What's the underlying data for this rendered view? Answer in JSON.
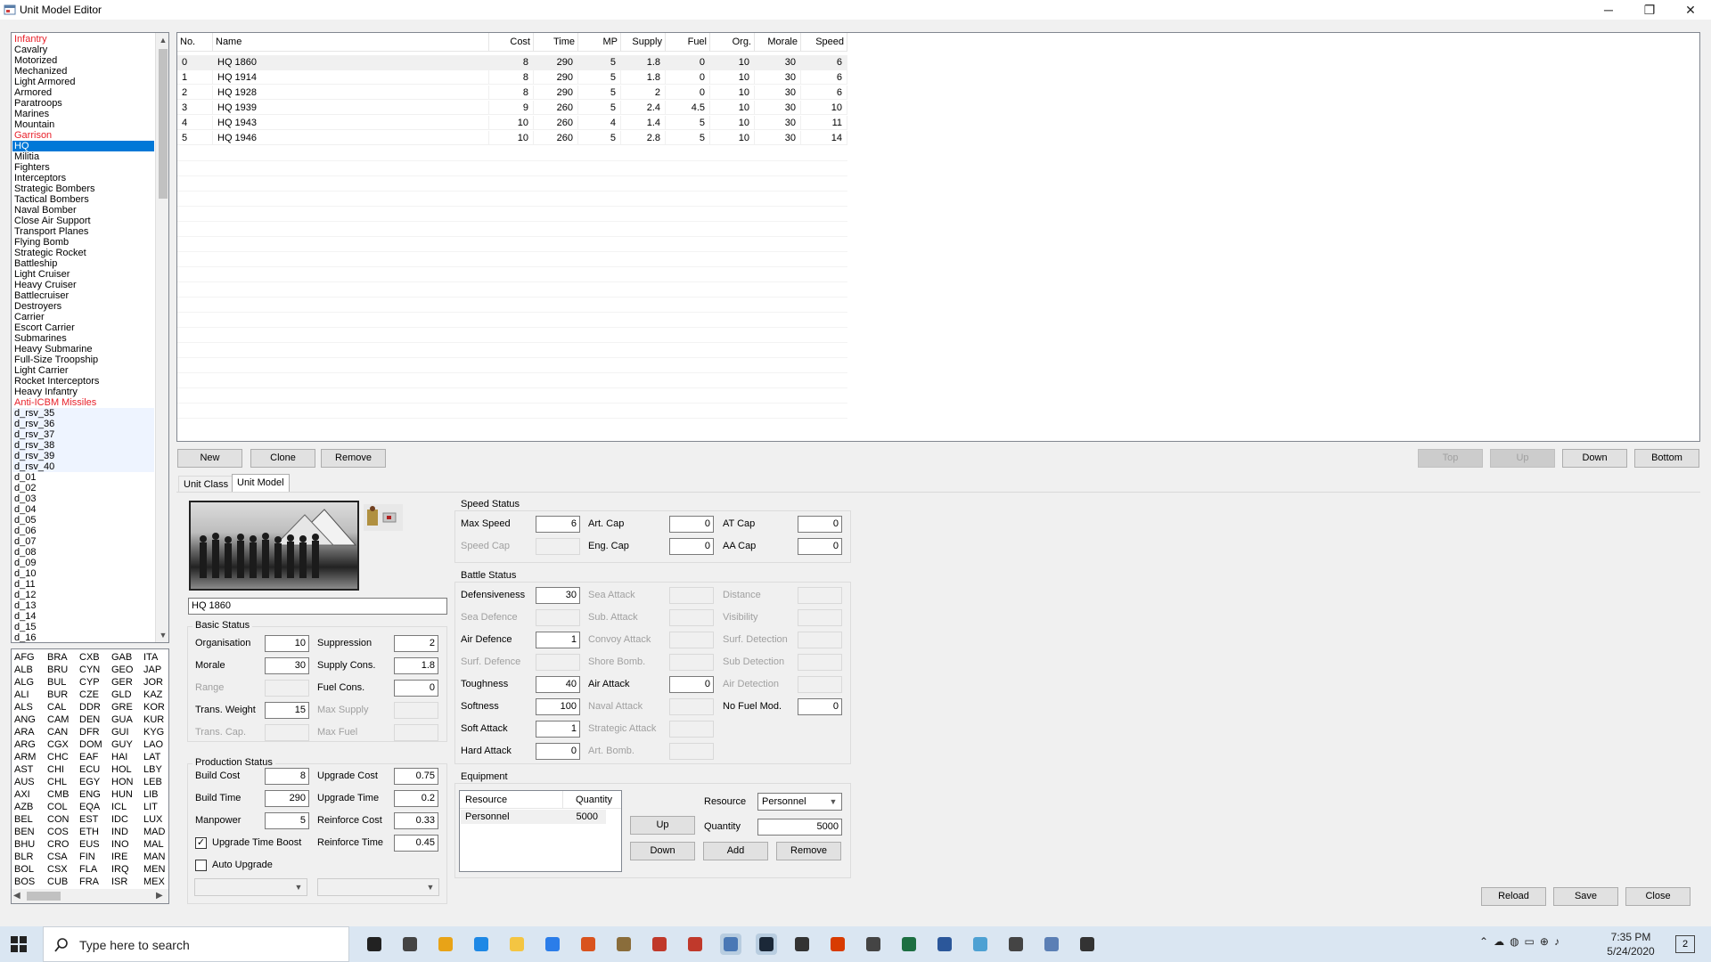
{
  "window": {
    "title": "Unit Model Editor",
    "minimize": "─",
    "restore": "❐",
    "close": "✕"
  },
  "unit_classes": [
    "Infantry",
    "Cavalry",
    "Motorized",
    "Mechanized",
    "Light Armored",
    "Armored",
    "Paratroops",
    "Marines",
    "Mountain",
    "Garrison",
    "HQ",
    "Militia",
    "Fighters",
    "Interceptors",
    "Strategic Bombers",
    "Tactical Bombers",
    "Naval Bomber",
    "Close Air Support",
    "Transport Planes",
    "Flying Bomb",
    "Strategic Rocket",
    "Battleship",
    "Light Cruiser",
    "Heavy Cruiser",
    "Battlecruiser",
    "Destroyers",
    "Carrier",
    "Escort Carrier",
    "Submarines",
    "Heavy Submarine",
    "Full-Size Troopship",
    "Light Carrier",
    "Rocket Interceptors",
    "Heavy Infantry",
    "Anti-ICBM Missiles",
    "d_rsv_35",
    "d_rsv_36",
    "d_rsv_37",
    "d_rsv_38",
    "d_rsv_39",
    "d_rsv_40",
    "d_01",
    "d_02",
    "d_03",
    "d_04",
    "d_05",
    "d_06",
    "d_07",
    "d_08",
    "d_09",
    "d_10",
    "d_11",
    "d_12",
    "d_13",
    "d_14",
    "d_15",
    "d_16"
  ],
  "unit_class_colors": {
    "red": "#e8202a",
    "selected_bg": "#0078d7"
  },
  "countries": [
    [
      "AFG",
      "BRA",
      "CXB",
      "GAB",
      "ITA"
    ],
    [
      "ALB",
      "BRU",
      "CYN",
      "GEO",
      "JAP"
    ],
    [
      "ALG",
      "BUL",
      "CYP",
      "GER",
      "JOR"
    ],
    [
      "ALI",
      "BUR",
      "CZE",
      "GLD",
      "KAZ"
    ],
    [
      "ALS",
      "CAL",
      "DDR",
      "GRE",
      "KOR"
    ],
    [
      "ANG",
      "CAM",
      "DEN",
      "GUA",
      "KUR"
    ],
    [
      "ARA",
      "CAN",
      "DFR",
      "GUI",
      "KYG"
    ],
    [
      "ARG",
      "CGX",
      "DOM",
      "GUY",
      "LAO"
    ],
    [
      "ARM",
      "CHC",
      "EAF",
      "HAI",
      "LAT"
    ],
    [
      "AST",
      "CHI",
      "ECU",
      "HOL",
      "LBY"
    ],
    [
      "AUS",
      "CHL",
      "EGY",
      "HON",
      "LEB"
    ],
    [
      "AXI",
      "CMB",
      "ENG",
      "HUN",
      "LIB"
    ],
    [
      "AZB",
      "COL",
      "EQA",
      "ICL",
      "LIT"
    ],
    [
      "BEL",
      "CON",
      "EST",
      "IDC",
      "LUX"
    ],
    [
      "BEN",
      "COS",
      "ETH",
      "IND",
      "MAD"
    ],
    [
      "BHU",
      "CRO",
      "EUS",
      "INO",
      "MAL"
    ],
    [
      "BLR",
      "CSA",
      "FIN",
      "IRE",
      "MAN"
    ],
    [
      "BOL",
      "CSX",
      "FLA",
      "IRQ",
      "MEN"
    ],
    [
      "BOS",
      "CUB",
      "FRA",
      "ISR",
      "MEX"
    ]
  ],
  "grid": {
    "columns": [
      "No.",
      "Name",
      "Cost",
      "Time",
      "MP",
      "Supply",
      "Fuel",
      "Org.",
      "Morale",
      "Speed"
    ],
    "rows": [
      [
        "0",
        "HQ 1860",
        "8",
        "290",
        "5",
        "1.8",
        "0",
        "10",
        "30",
        "6"
      ],
      [
        "1",
        "HQ 1914",
        "8",
        "290",
        "5",
        "1.8",
        "0",
        "10",
        "30",
        "6"
      ],
      [
        "2",
        "HQ 1928",
        "8",
        "290",
        "5",
        "2",
        "0",
        "10",
        "30",
        "6"
      ],
      [
        "3",
        "HQ 1939",
        "9",
        "260",
        "5",
        "2.4",
        "4.5",
        "10",
        "30",
        "10"
      ],
      [
        "4",
        "HQ 1943",
        "10",
        "260",
        "4",
        "1.4",
        "5",
        "10",
        "30",
        "11"
      ],
      [
        "5",
        "HQ 1946",
        "10",
        "260",
        "5",
        "2.8",
        "5",
        "10",
        "30",
        "14"
      ]
    ]
  },
  "buttons": {
    "new": "New",
    "clone": "Clone",
    "remove": "Remove",
    "top": "Top",
    "up": "Up",
    "down": "Down",
    "bottom": "Bottom",
    "reload": "Reload",
    "save": "Save",
    "close": "Close"
  },
  "tabs": {
    "unit_class": "Unit Class",
    "unit_model": "Unit Model"
  },
  "model_name": "HQ 1860",
  "basic": {
    "title": "Basic Status",
    "organisation": {
      "label": "Organisation",
      "value": "10"
    },
    "morale": {
      "label": "Morale",
      "value": "30"
    },
    "range": {
      "label": "Range",
      "value": ""
    },
    "trans_weight": {
      "label": "Trans. Weight",
      "value": "15"
    },
    "trans_cap": {
      "label": "Trans. Cap.",
      "value": ""
    },
    "suppression": {
      "label": "Suppression",
      "value": "2"
    },
    "supply_cons": {
      "label": "Supply Cons.",
      "value": "1.8"
    },
    "fuel_cons": {
      "label": "Fuel Cons.",
      "value": "0"
    },
    "max_supply": {
      "label": "Max Supply",
      "value": ""
    },
    "max_fuel": {
      "label": "Max Fuel",
      "value": ""
    }
  },
  "production": {
    "title": "Production Status",
    "build_cost": {
      "label": "Build Cost",
      "value": "8"
    },
    "build_time": {
      "label": "Build Time",
      "value": "290"
    },
    "manpower": {
      "label": "Manpower",
      "value": "5"
    },
    "upgrade_cost": {
      "label": "Upgrade Cost",
      "value": "0.75"
    },
    "upgrade_time": {
      "label": "Upgrade Time",
      "value": "0.2"
    },
    "reinforce_cost": {
      "label": "Reinforce Cost",
      "value": "0.33"
    },
    "reinforce_time": {
      "label": "Reinforce Time",
      "value": "0.45"
    },
    "upgrade_time_boost": {
      "label": "Upgrade Time Boost",
      "checked": "✓"
    },
    "auto_upgrade": {
      "label": "Auto Upgrade",
      "checked": ""
    }
  },
  "speed": {
    "title": "Speed Status",
    "max_speed": {
      "label": "Max Speed",
      "value": "6"
    },
    "speed_cap": {
      "label": "Speed Cap",
      "value": ""
    },
    "art_cap": {
      "label": "Art. Cap",
      "value": "0"
    },
    "eng_cap": {
      "label": "Eng. Cap",
      "value": "0"
    },
    "at_cap": {
      "label": "AT Cap",
      "value": "0"
    },
    "aa_cap": {
      "label": "AA Cap",
      "value": "0"
    }
  },
  "battle": {
    "title": "Battle Status",
    "defensiveness": {
      "label": "Defensiveness",
      "value": "30"
    },
    "sea_defence": {
      "label": "Sea Defence",
      "value": ""
    },
    "air_defence": {
      "label": "Air Defence",
      "value": "1"
    },
    "surf_defence": {
      "label": "Surf. Defence",
      "value": ""
    },
    "toughness": {
      "label": "Toughness",
      "value": "40"
    },
    "softness": {
      "label": "Softness",
      "value": "100"
    },
    "soft_attack": {
      "label": "Soft Attack",
      "value": "1"
    },
    "hard_attack": {
      "label": "Hard Attack",
      "value": "0"
    },
    "sea_attack": {
      "label": "Sea Attack",
      "value": ""
    },
    "sub_attack": {
      "label": "Sub. Attack",
      "value": ""
    },
    "convoy_attack": {
      "label": "Convoy Attack",
      "value": ""
    },
    "shore_bomb": {
      "label": "Shore Bomb.",
      "value": ""
    },
    "air_attack": {
      "label": "Air Attack",
      "value": "0"
    },
    "naval_attack": {
      "label": "Naval Attack",
      "value": ""
    },
    "strategic_attack": {
      "label": "Strategic Attack",
      "value": ""
    },
    "art_bomb": {
      "label": "Art. Bomb.",
      "value": ""
    },
    "distance": {
      "label": "Distance",
      "value": ""
    },
    "visibility": {
      "label": "Visibility",
      "value": ""
    },
    "surf_detection": {
      "label": "Surf. Detection",
      "value": ""
    },
    "sub_detection": {
      "label": "Sub Detection",
      "value": ""
    },
    "air_detection": {
      "label": "Air Detection",
      "value": ""
    },
    "no_fuel_mod": {
      "label": "No Fuel Mod.",
      "value": "0"
    }
  },
  "equipment": {
    "title": "Equipment",
    "columns": [
      "Resource",
      "Quantity"
    ],
    "rows": [
      [
        "Personnel",
        "5000"
      ]
    ],
    "resource_label": "Resource",
    "resource_value": "Personnel",
    "quantity_label": "Quantity",
    "quantity_value": "5000",
    "up": "Up",
    "down": "Down",
    "add": "Add",
    "remove": "Remove"
  },
  "taskbar": {
    "search_placeholder": "Type here to search",
    "time": "7:35 PM",
    "date": "5/24/2020",
    "notifications": "2",
    "apps": [
      "cortana-icon",
      "task-view-icon",
      "chrome-icon",
      "edge-icon",
      "file-explorer-icon",
      "mail-icon",
      "git-icon",
      "game-globe-icon",
      "game-red-icon",
      "game-banner-icon",
      "app-window-icon",
      "steam-icon",
      "iron-cross-icon",
      "office-icon",
      "store-icon",
      "excel-icon",
      "word-icon",
      "control-panel-icon",
      "settings-icon",
      "editor-icon",
      "sticky-notes-icon"
    ]
  }
}
